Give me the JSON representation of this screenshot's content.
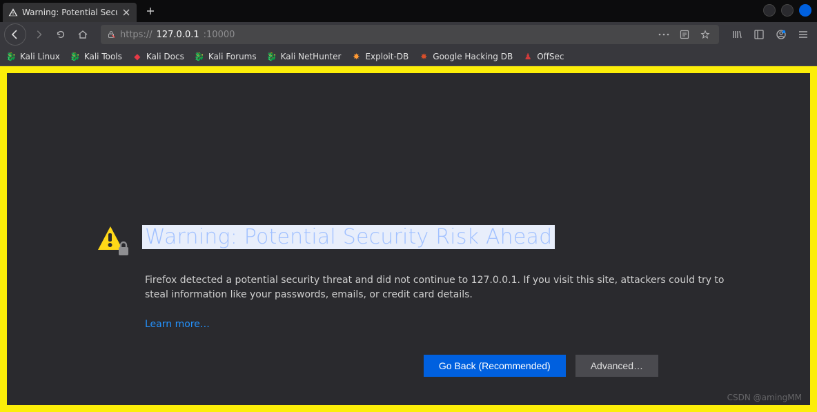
{
  "tab": {
    "title": "Warning: Potential Security Risk Ahead"
  },
  "url": {
    "prefix": "https://",
    "host": "127.0.0.1",
    "rest": ":10000"
  },
  "bookmarks": [
    {
      "label": "Kali Linux",
      "icon": "🐉",
      "color": "#333"
    },
    {
      "label": "Kali Tools",
      "icon": "🐉",
      "color": "#0a84ff"
    },
    {
      "label": "Kali Docs",
      "icon": "◆",
      "color": "#e63946"
    },
    {
      "label": "Kali Forums",
      "icon": "🐉",
      "color": "#555"
    },
    {
      "label": "Kali NetHunter",
      "icon": "🐉",
      "color": "#e63946"
    },
    {
      "label": "Exploit-DB",
      "icon": "✸",
      "color": "#ff9933"
    },
    {
      "label": "Google Hacking DB",
      "icon": "✸",
      "color": "#d94f2a"
    },
    {
      "label": "OffSec",
      "icon": "♟",
      "color": "#d13b3b"
    }
  ],
  "error": {
    "title": "Warning: Potential Security Risk Ahead",
    "body": "Firefox detected a potential security threat and did not continue to 127.0.0.1. If you visit this site, attackers could try to steal information like your passwords, emails, or credit card details.",
    "learn_more": "Learn more…",
    "go_back": "Go Back (Recommended)",
    "advanced": "Advanced…"
  },
  "watermark": "CSDN @amingMM",
  "watermark2": ""
}
